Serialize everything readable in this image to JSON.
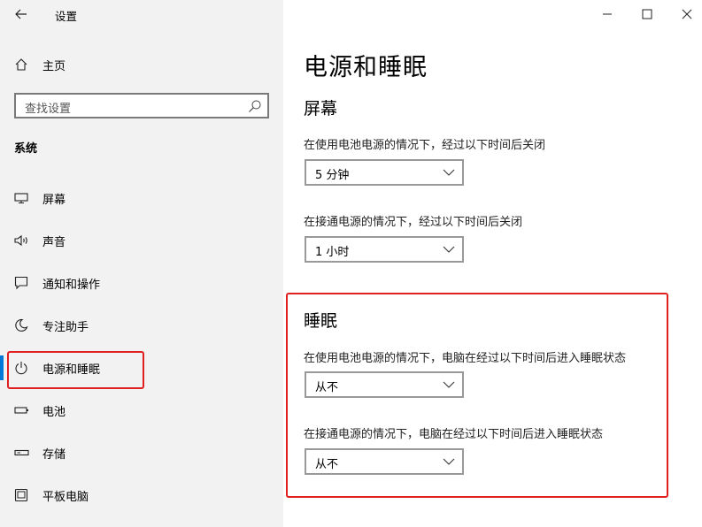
{
  "window": {
    "title": "设置"
  },
  "sidebar": {
    "home_label": "主页",
    "search_placeholder": "查找设置",
    "group_title": "系统",
    "items": [
      {
        "label": "屏幕",
        "icon": "monitor-icon"
      },
      {
        "label": "声音",
        "icon": "speaker-icon"
      },
      {
        "label": "通知和操作",
        "icon": "notification-icon"
      },
      {
        "label": "专注助手",
        "icon": "moon-icon"
      },
      {
        "label": "电源和睡眠",
        "icon": "power-icon",
        "selected": true
      },
      {
        "label": "电池",
        "icon": "battery-icon"
      },
      {
        "label": "存储",
        "icon": "storage-icon"
      },
      {
        "label": "平板电脑",
        "icon": "tablet-icon"
      }
    ]
  },
  "main": {
    "title": "电源和睡眠",
    "screen": {
      "heading": "屏幕",
      "battery_label": "在使用电池电源的情况下，经过以下时间后关闭",
      "battery_value": "5 分钟",
      "plugged_label": "在接通电源的情况下，经过以下时间后关闭",
      "plugged_value": "1 小时"
    },
    "sleep": {
      "heading": "睡眠",
      "battery_label": "在使用电池电源的情况下，电脑在经过以下时间后进入睡眠状态",
      "battery_value": "从不",
      "plugged_label": "在接通电源的情况下，电脑在经过以下时间后进入睡眠状态",
      "plugged_value": "从不"
    }
  },
  "colors": {
    "accent": "#0078d7",
    "highlight": "#e02020",
    "sidebar_bg": "#f2f2f2"
  }
}
